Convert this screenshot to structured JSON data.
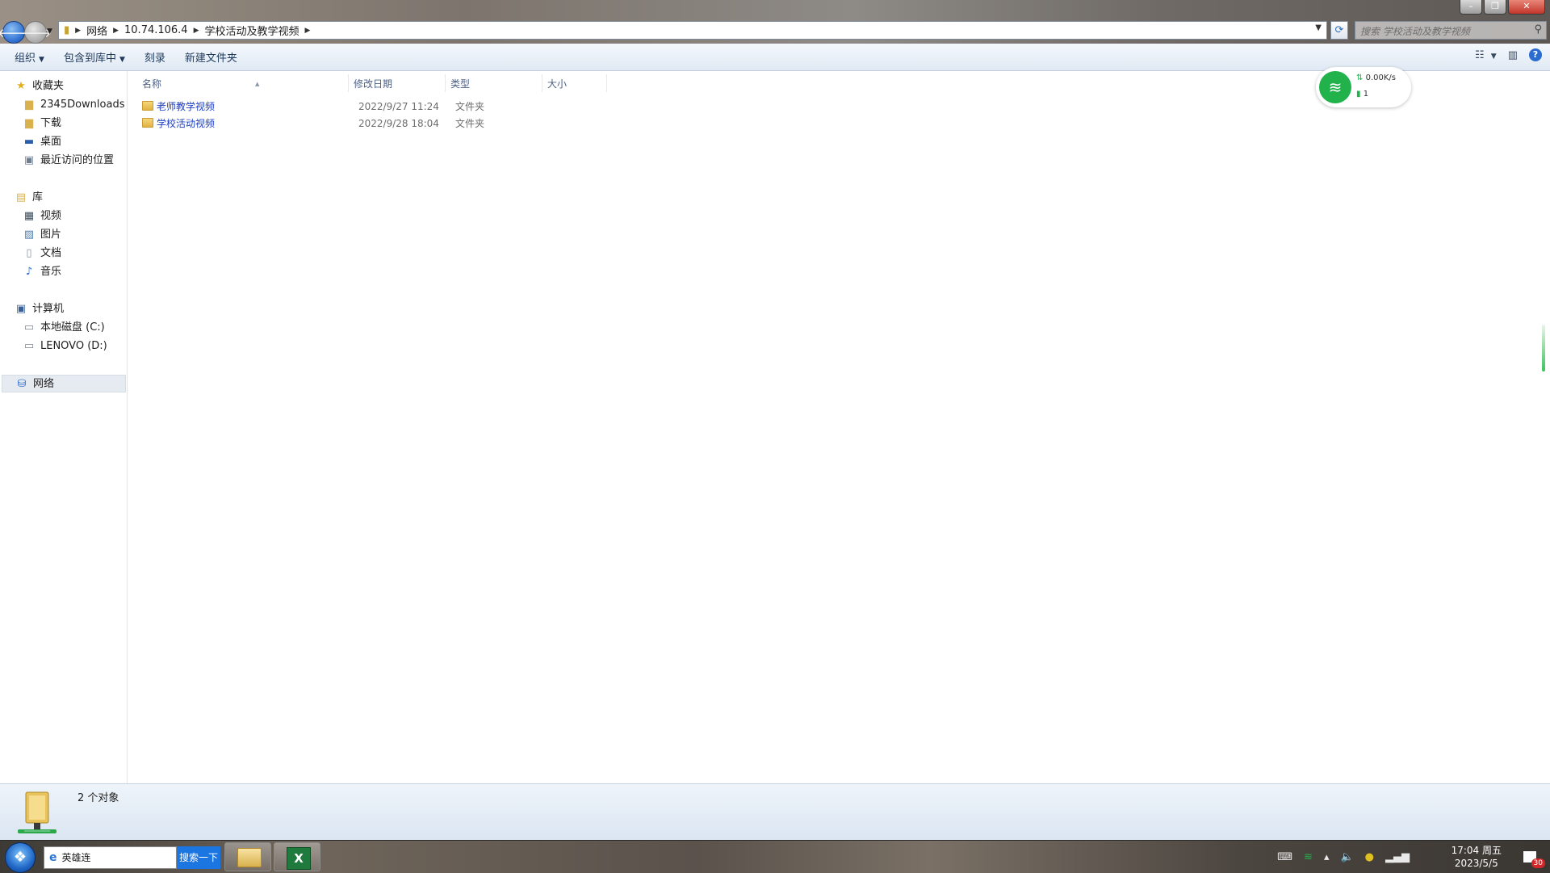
{
  "address": {
    "crumbs": [
      "网络",
      "10.74.106.4",
      "学校活动及教学视频"
    ]
  },
  "search": {
    "placeholder": "搜索 学校活动及教学视频"
  },
  "toolbar": {
    "organize": "组织",
    "include_in_library": "包含到库中",
    "burn": "刻录",
    "new_folder": "新建文件夹"
  },
  "nav": {
    "favorites": "收藏夹",
    "fav_items": [
      "2345Downloads",
      "下载",
      "桌面",
      "最近访问的位置"
    ],
    "libraries": "库",
    "lib_items": [
      "视频",
      "图片",
      "文档",
      "音乐"
    ],
    "computer": "计算机",
    "computer_items": [
      "本地磁盘 (C:)",
      "LENOVO (D:)"
    ],
    "network": "网络"
  },
  "columns": {
    "name": "名称",
    "modified": "修改日期",
    "type": "类型",
    "size": "大小"
  },
  "files": [
    {
      "name": "老师教学视频",
      "modified": "2022/9/27 11:24",
      "type": "文件夹"
    },
    {
      "name": "学校活动视频",
      "modified": "2022/9/28 18:04",
      "type": "文件夹"
    }
  ],
  "wifi": {
    "speed": "0.00K/s",
    "devices": "1"
  },
  "details": {
    "count": "2 个对象"
  },
  "taskbar": {
    "search_value": "英雄连",
    "search_button": "搜索一下",
    "time": "17:04 周五",
    "date": "2023/5/5",
    "notify_count": "30"
  }
}
